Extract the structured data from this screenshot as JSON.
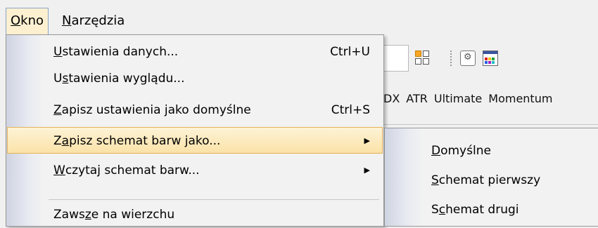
{
  "menubar": {
    "items": [
      {
        "pre": "",
        "ul": "O",
        "post": "kno"
      },
      {
        "pre": "",
        "ul": "N",
        "post": "arzędzia"
      }
    ]
  },
  "toolbar": {
    "indicators": [
      "DX",
      "ATR",
      "Ultimate",
      "Momentum"
    ]
  },
  "okno_menu": {
    "items": [
      {
        "pre": "",
        "ul": "U",
        "post": "stawienia danych...",
        "shortcut": "Ctrl+U"
      },
      {
        "pre": "U",
        "ul": "s",
        "post": "tawienia wyglądu...",
        "shortcut": ""
      },
      {
        "pre": "",
        "ul": "Z",
        "post": "apisz ustawienia jako domyślne",
        "shortcut": "Ctrl+S"
      },
      {
        "pre": "Z",
        "ul": "a",
        "post": "pisz schemat barw jako...",
        "shortcut": "",
        "submenu": true
      },
      {
        "pre": "",
        "ul": "W",
        "post": "czytaj schemat barw...",
        "shortcut": "",
        "submenu": true
      },
      {
        "pre": "Zaws",
        "ul": "z",
        "post": "e na wierzchu",
        "shortcut": ""
      }
    ]
  },
  "submenu": {
    "items": [
      {
        "pre": "",
        "ul": "D",
        "post": "omyślne"
      },
      {
        "pre": "",
        "ul": "S",
        "post": "chemat pierwszy"
      },
      {
        "pre": "S",
        "ul": "c",
        "post": "hemat drugi"
      }
    ]
  },
  "icons": {
    "submenu_arrow": "▶",
    "gear": "⚙"
  },
  "colors": {
    "highlight_top": "#fdf3d6",
    "highlight_bottom": "#fbe2a8",
    "highlight_border": "#e3b25a",
    "gutter": "#cfd4e2"
  }
}
